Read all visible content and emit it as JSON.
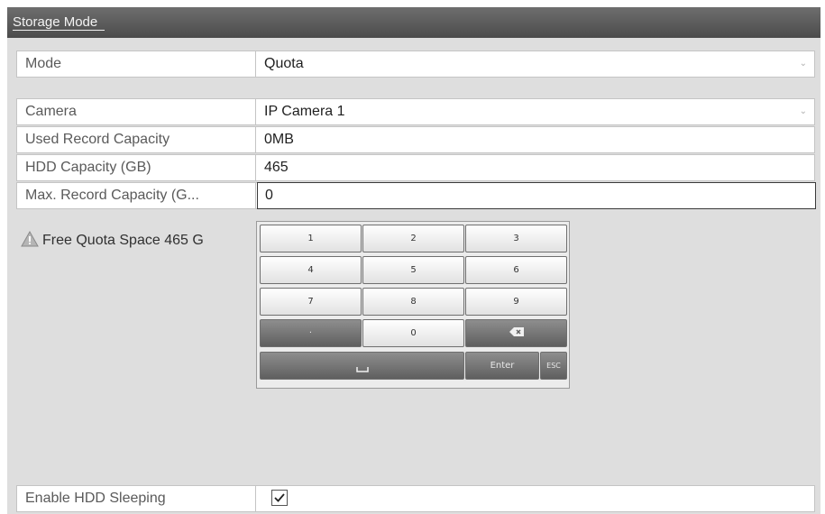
{
  "title": "Storage Mode",
  "mode": {
    "label": "Mode",
    "value": "Quota"
  },
  "camera": {
    "label": "Camera",
    "value": "IP Camera 1"
  },
  "used_record": {
    "label": "Used Record Capacity",
    "value": "0MB"
  },
  "hdd_capacity": {
    "label": "HDD Capacity (GB)",
    "value": "465"
  },
  "max_record": {
    "label": "Max. Record Capacity (G...",
    "value": "0"
  },
  "warning": {
    "text": "Free Quota Space 465 G",
    "icon": "warning-triangle-icon"
  },
  "keypad": {
    "row1": [
      "1",
      "2",
      "3"
    ],
    "row2": [
      "4",
      "5",
      "6"
    ],
    "row3": [
      "7",
      "8",
      "9"
    ],
    "dot": "·",
    "zero": "0",
    "backspace_icon": "backspace-icon",
    "space_icon": "space-bar-icon",
    "enter": "Enter",
    "esc": "ESC"
  },
  "hdd_sleep": {
    "label": "Enable HDD Sleeping",
    "checked": true
  }
}
